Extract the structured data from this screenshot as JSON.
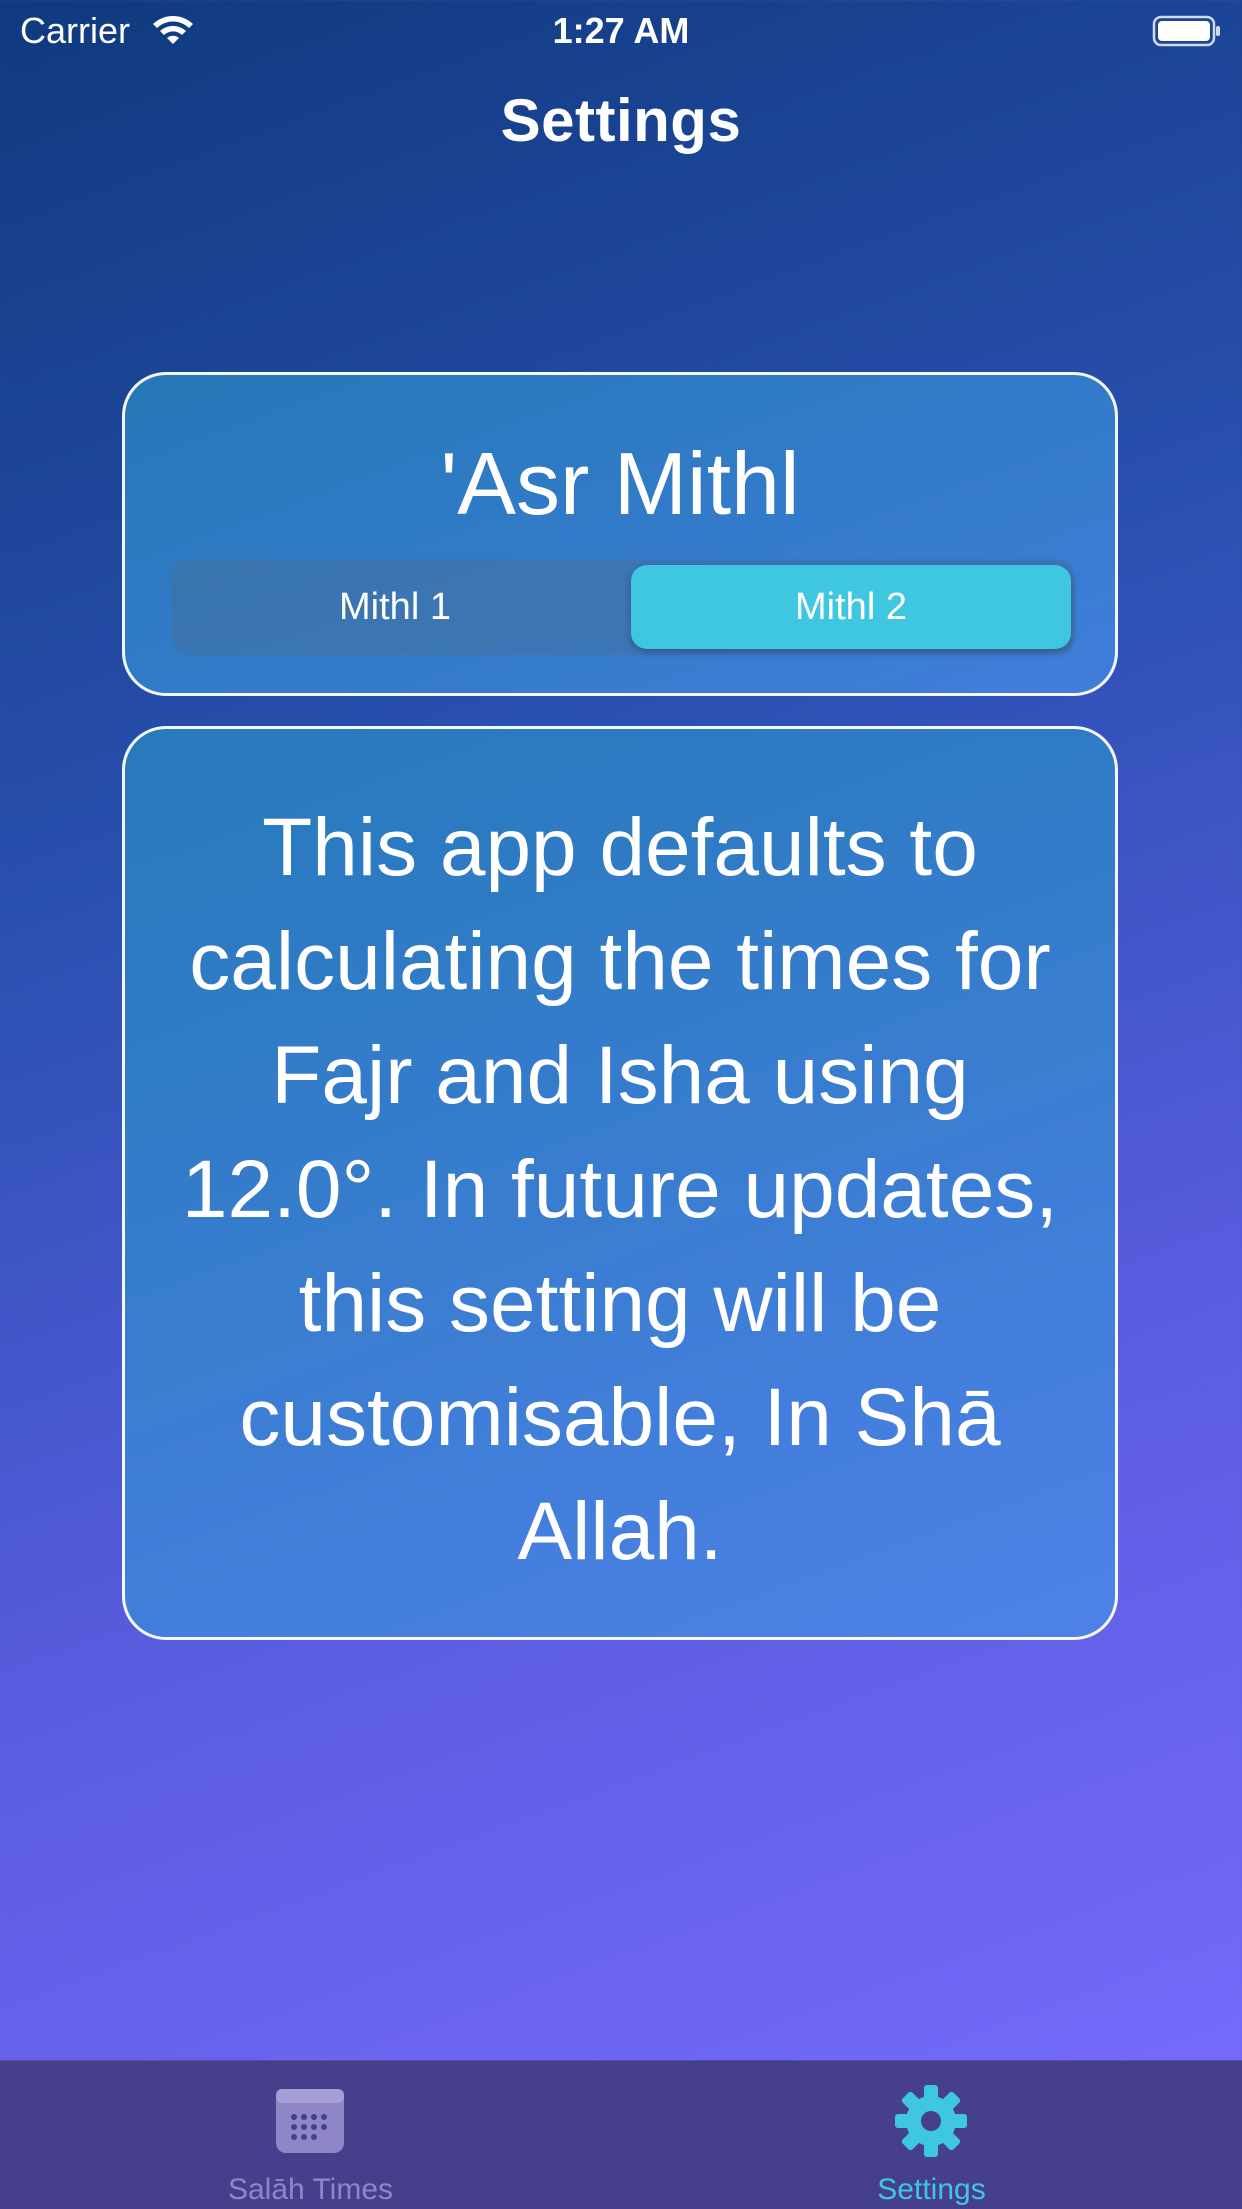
{
  "status_bar": {
    "carrier": "Carrier",
    "time": "1:27 AM",
    "wifi_icon": "wifi-icon",
    "battery_icon": "battery-icon"
  },
  "nav": {
    "title": "Settings"
  },
  "asr_card": {
    "title": "'Asr Mithl",
    "segments": [
      "Mithl 1",
      "Mithl 2"
    ],
    "selected": "Mithl 2"
  },
  "info_card": {
    "text": "This app defaults to calculating the times for Fajr and Isha using 12.0°. In future updates, this setting will be customisable, In Shā Allah."
  },
  "tab_bar": {
    "tabs": [
      {
        "label": "Salāh Times",
        "icon": "calendar-icon",
        "selected": false
      },
      {
        "label": "Settings",
        "icon": "gear-icon",
        "selected": true
      }
    ]
  },
  "colors": {
    "accent": "#3fc6e0",
    "tab_bar_bg": "#463f8c",
    "tab_inactive": "#8f86c8"
  }
}
